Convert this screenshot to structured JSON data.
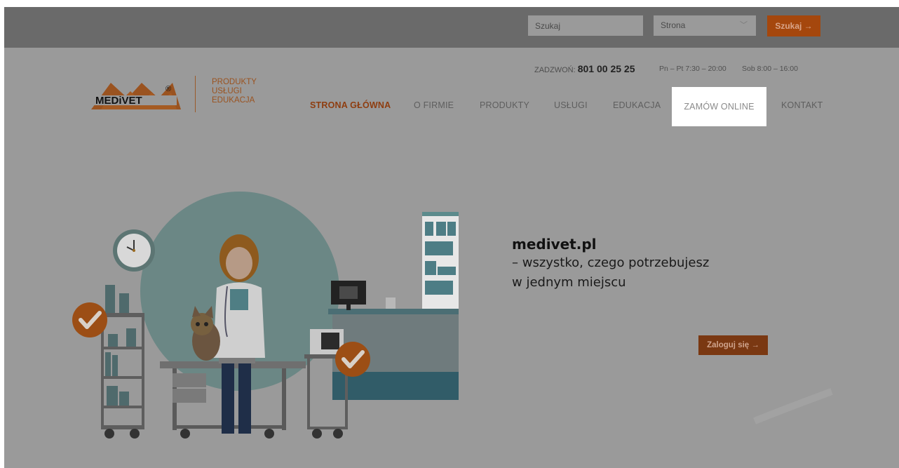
{
  "search": {
    "placeholder": "Szukaj",
    "scope_value": "Strona",
    "button_label": "Szukaj →"
  },
  "brand": {
    "logo_text": "MEDiVET",
    "logo_mark": "®",
    "tagline": [
      "PRODUKTY",
      "USŁUGI",
      "EDUKACJA"
    ]
  },
  "contact": {
    "label": "ZADZWOŃ:",
    "phone": "801 00 25 25",
    "hours_weekday": "Pn – Pt 7:30 – 20:00",
    "hours_saturday": "Sob 8:00 – 16:00"
  },
  "nav": {
    "items": [
      {
        "label": "STRONA GŁÓWNA",
        "active": true
      },
      {
        "label": "O FIRMIE",
        "active": false
      },
      {
        "label": "PRODUKTY",
        "active": false
      },
      {
        "label": "USŁUGI",
        "active": false
      },
      {
        "label": "EDUKACJA",
        "active": false
      },
      {
        "label": "ZAMÓW ONLINE",
        "active": false,
        "highlighted": true
      },
      {
        "label": "KONTAKT",
        "active": false
      }
    ]
  },
  "hero": {
    "title": "medivet.pl",
    "line1": "– wszystko, czego potrzebujesz",
    "line2": "w jednym miejscu",
    "login_label": "Zaloguj się →"
  },
  "colors": {
    "overlay": "#9a9a9a",
    "topbar": "#6a6a6a",
    "accent": "#a5470d",
    "nav_active": "#8e3d10"
  },
  "icons": [
    "chevron-down-icon",
    "arrow-right-icon",
    "clock-icon",
    "checkmark-icon"
  ]
}
